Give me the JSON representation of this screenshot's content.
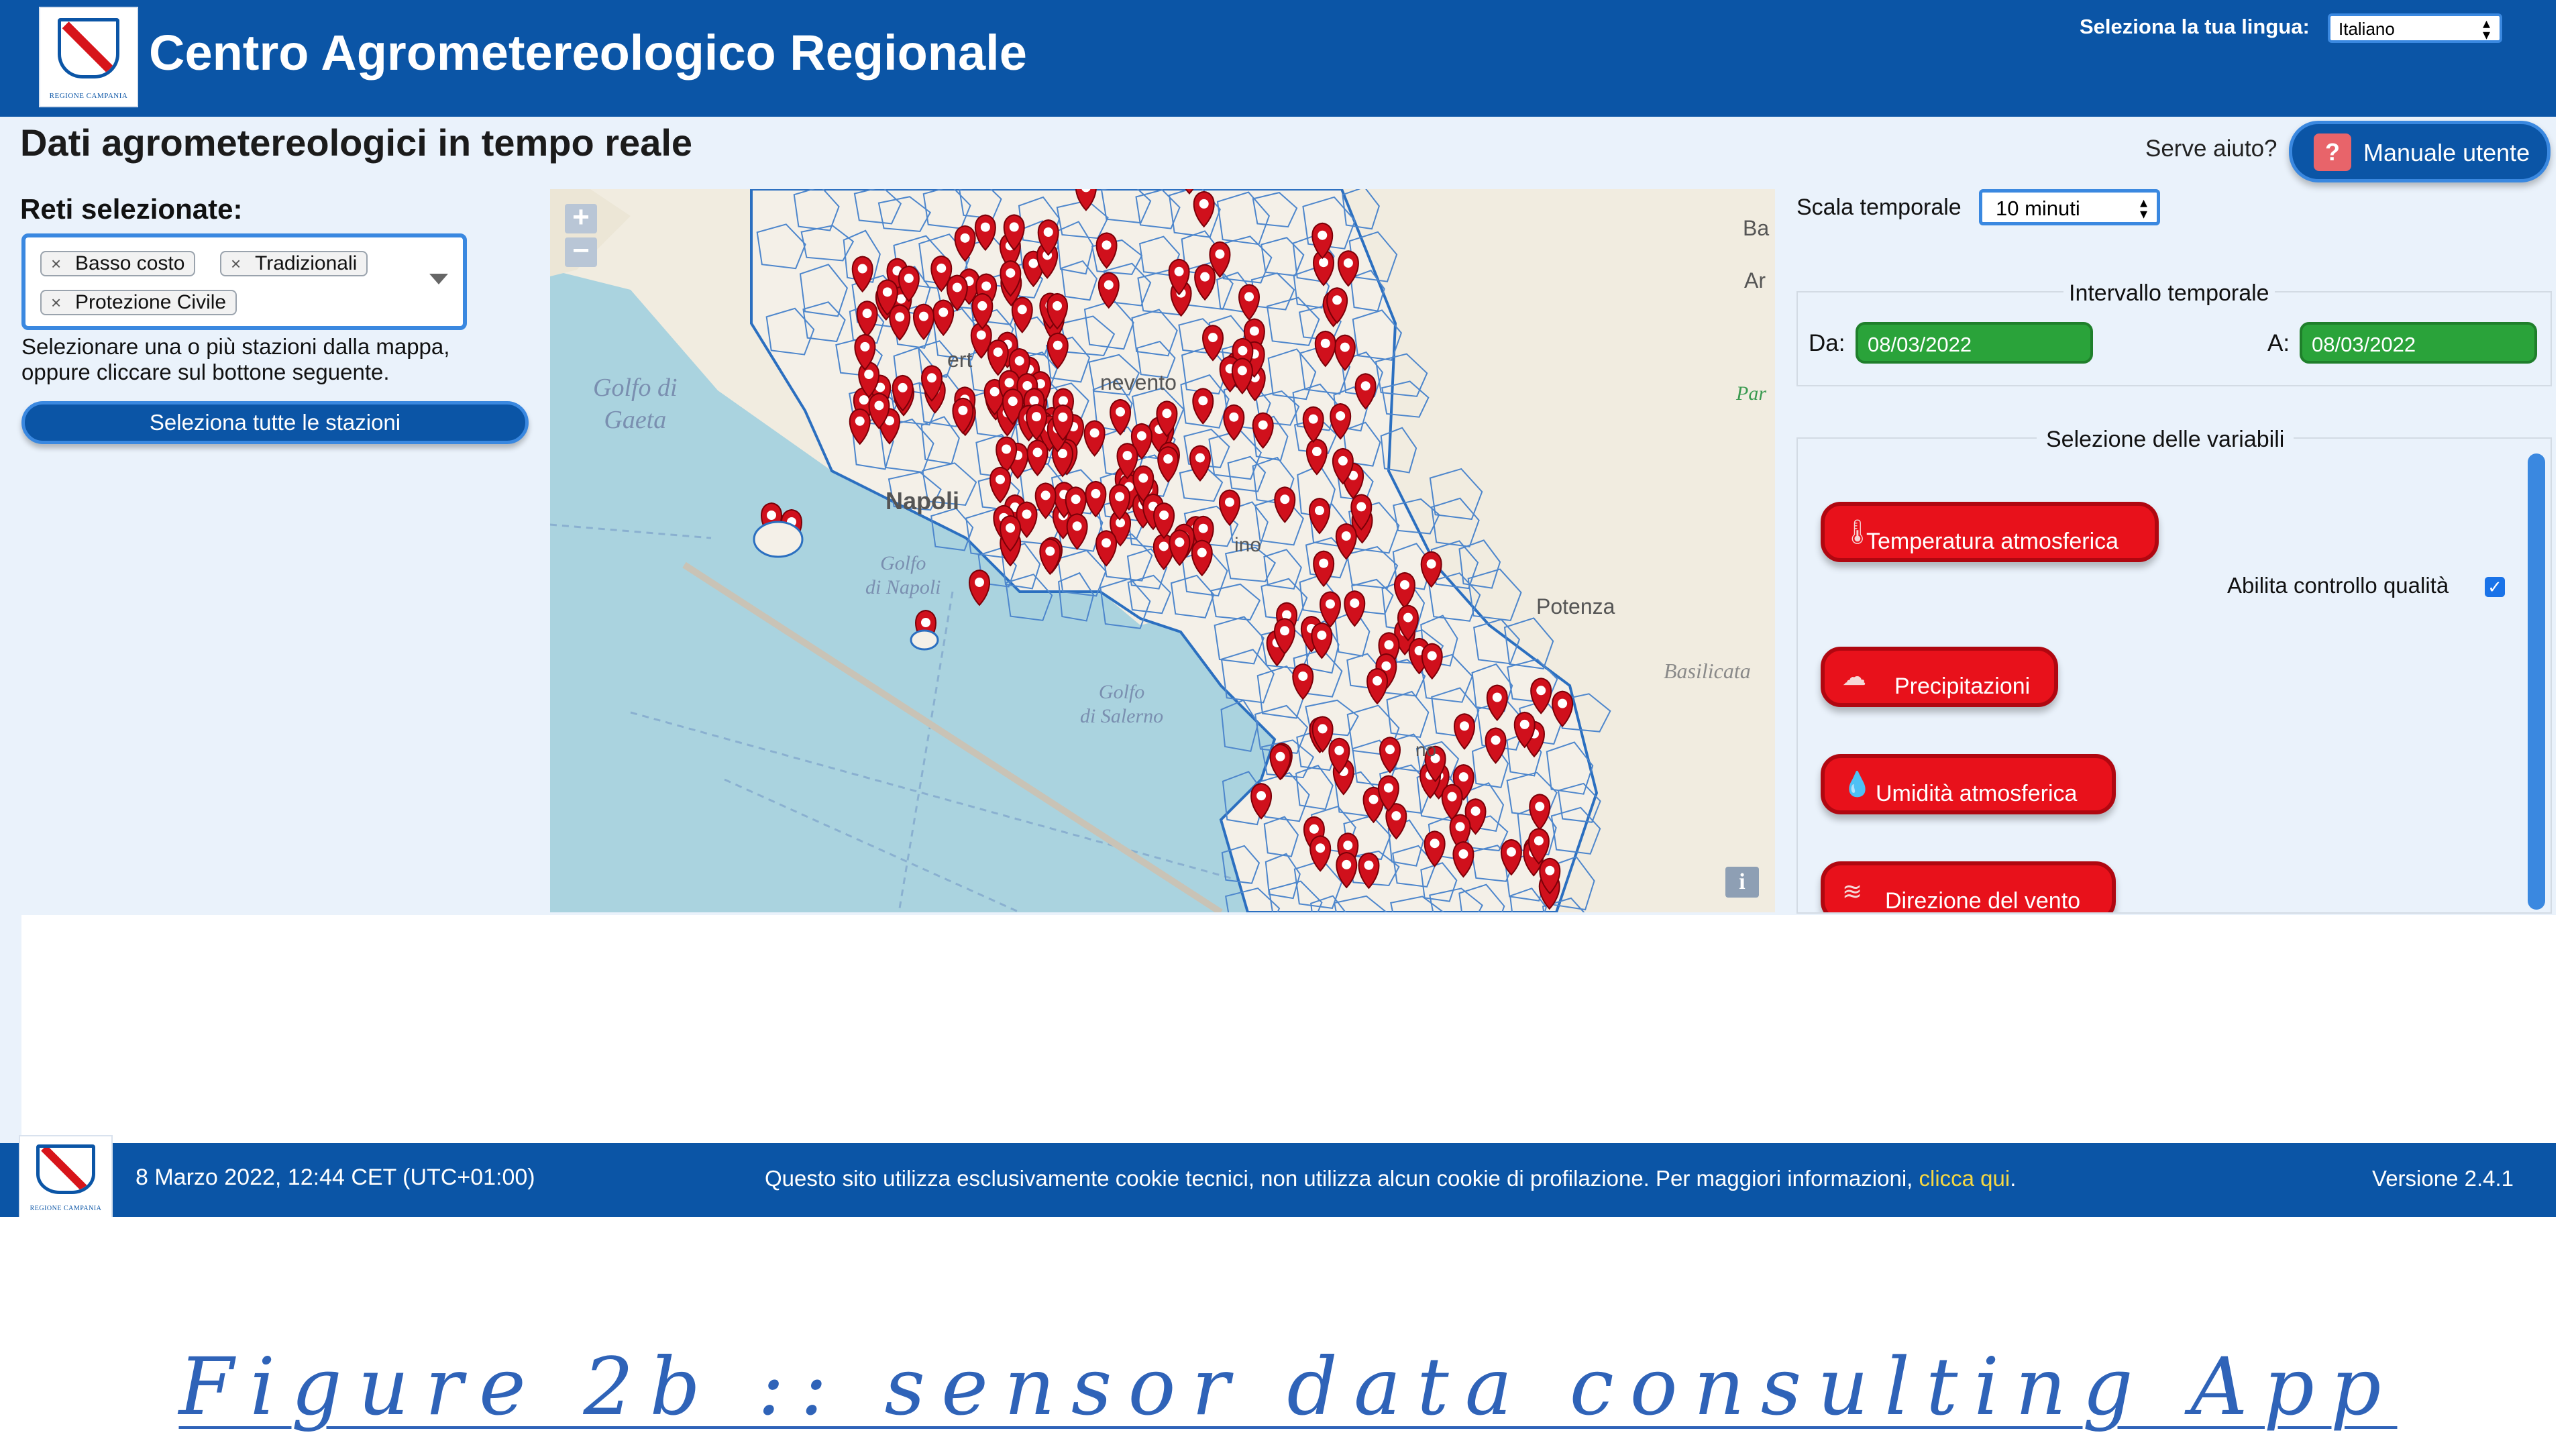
{
  "header": {
    "title": "Centro Agrometereologico Regionale",
    "logo_caption": "REGIONE CAMPANIA",
    "language_label": "Seleziona la tua lingua:",
    "language_value": "Italiano"
  },
  "page": {
    "title": "Dati agrometereologici in tempo reale",
    "help_text": "Serve aiuto?",
    "manual_button": "Manuale utente"
  },
  "networks": {
    "label": "Reti selezionate:",
    "chips": [
      "Basso costo",
      "Tradizionali",
      "Protezione Civile"
    ],
    "hint_line1": "Selezionare una o più stazioni dalla mappa,",
    "hint_line2": "oppure cliccare sul bottone seguente.",
    "select_all_button": "Seleziona tutte le stazioni"
  },
  "map": {
    "zoom_in": "+",
    "zoom_out": "−",
    "info": "i",
    "labels": {
      "gulf_gaeta_1": "Golfo di",
      "gulf_gaeta_2": "Gaeta",
      "gulf_napoli_1": "Golfo",
      "gulf_napoli_2": "di Napoli",
      "gulf_salerno_1": "Golfo",
      "gulf_salerno_2": "di Salerno",
      "potenza": "Potenza",
      "basilicata": "Basilicata",
      "napoli": "Napoli",
      "benevento": "nevento",
      "caserta": "ert",
      "avellino": "ino",
      "ba": "Ba",
      "ar": "Ar",
      "par": "Par",
      "cilento": "no"
    },
    "colors": {
      "sea": "#aad3df",
      "land": "#f2efe9",
      "borders": "#2b6fc0",
      "marker": "#d0101c"
    }
  },
  "controls": {
    "scale_label": "Scala temporale",
    "scale_value": "10 minuti",
    "interval_title": "Intervallo temporale",
    "from_label": "Da:",
    "from_value": "08/03/2022",
    "to_label": "A:",
    "to_value": "08/03/2022",
    "variables_title": "Selezione delle variabili",
    "variables": [
      {
        "label": "Temperatura atmosferica",
        "icon": "thermometer-icon"
      },
      {
        "label": "Precipitazioni",
        "icon": "rain-cloud-icon"
      },
      {
        "label": "Umidità atmosferica",
        "icon": "water-drop-icon"
      },
      {
        "label": "Direzione del vento",
        "icon": "wind-icon"
      }
    ],
    "quality_label": "Abilita controllo qualità",
    "quality_checked": true
  },
  "footer": {
    "datetime": "8 Marzo 2022, 12:44 CET (UTC+01:00)",
    "cookie_text": "Questo sito utilizza esclusivamente cookie tecnici, non utilizza alcun cookie di profilazione. Per maggiori informazioni,",
    "cookie_link": "clicca qui",
    "cookie_end": ".",
    "version": "Versione 2.4.1"
  },
  "caption": "Figure 2b :: sensor data consulting App"
}
